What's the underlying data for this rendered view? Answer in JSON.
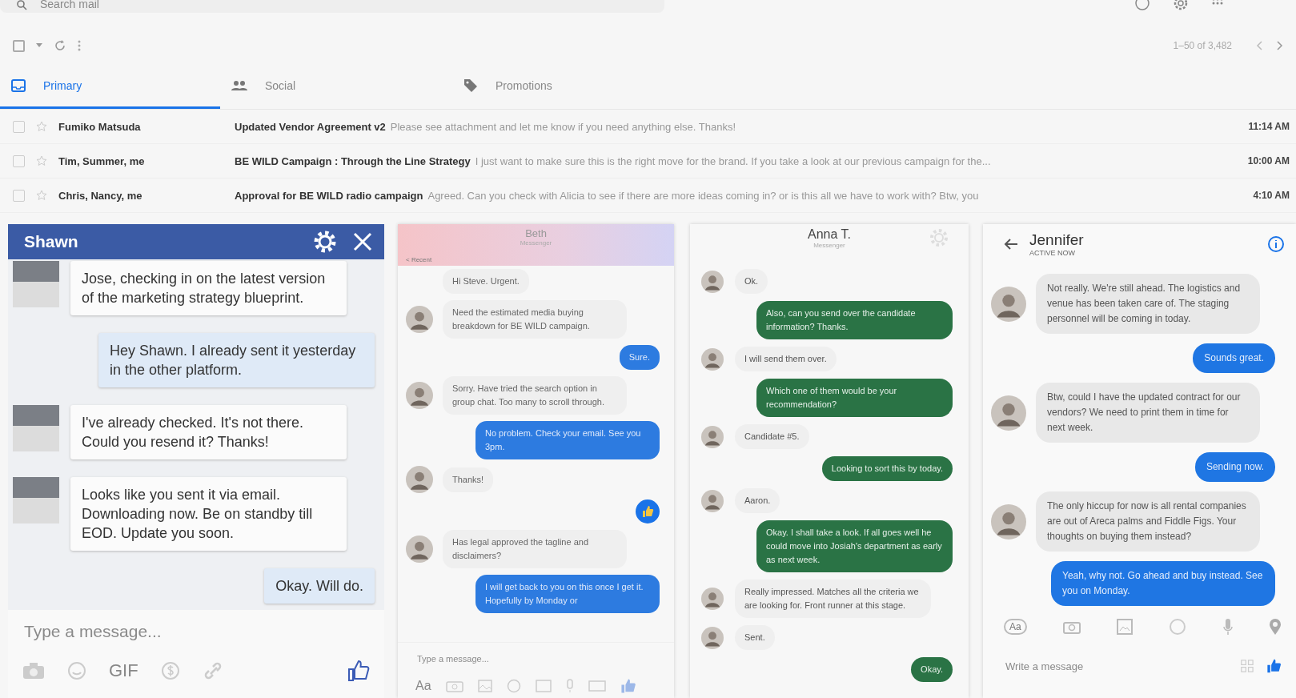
{
  "search": {
    "placeholder": "Search mail"
  },
  "toolbar": {
    "range": "1–50 of 3,482",
    "all_checked": false
  },
  "tabs": [
    {
      "label": "Primary",
      "selected": true,
      "kind": "inbox"
    },
    {
      "label": "Social",
      "selected": false,
      "kind": "people"
    },
    {
      "label": "Promotions",
      "selected": false,
      "kind": "tag"
    }
  ],
  "emails": [
    {
      "checked": false,
      "sender": "Fumiko Matsuda",
      "subject": "Updated Vendor Agreement v2",
      "snippet": "Please see attachment and let me know if you need anything else.  Thanks!",
      "time": "11:14 AM"
    },
    {
      "checked": false,
      "sender": "Tim, Summer, me",
      "subject": "BE WILD Campaign : Through the Line Strategy",
      "snippet": "I just want to make sure this is the right move for the brand. If you take a look at our previous campaign for the...",
      "time": "10:00 AM"
    },
    {
      "checked": false,
      "sender": "Chris, Nancy, me",
      "subject": "Approval for BE WILD radio campaign",
      "snippet": "Agreed. Can you check with Alicia to see if there are more ideas coming in? or is this all we have to work with? Btw, you",
      "time": "4:10 AM"
    }
  ],
  "chats": [
    {
      "kind": "classic",
      "title": "Shawn",
      "placeholder": "Type a message...",
      "footer_label": "GIF",
      "messages": [
        {
          "kind": "received",
          "text": "Jose, checking in on the latest version of the marketing strategy blueprint."
        },
        {
          "kind": "sent",
          "text": "Hey Shawn. I already sent it yesterday in the other platform."
        },
        {
          "kind": "received",
          "text": "I've already checked. It's not there. Could you resend it? Thanks!"
        },
        {
          "kind": "received",
          "text": "Looks like you sent it via email. Downloading now. Be on standby till EOD. Update you soon."
        },
        {
          "kind": "sent",
          "text": "Okay. Will do."
        }
      ]
    },
    {
      "kind": "gradient",
      "title": "Beth",
      "subtitle": "Messenger",
      "back": "< Recent",
      "placeholder": "Type a message...",
      "footer_label": "Aa",
      "messages": [
        {
          "kind": "received",
          "avatar": false,
          "text": "Hi Steve. Urgent."
        },
        {
          "kind": "received",
          "avatar": true,
          "text": "Need the estimated media buying breakdown for BE WILD campaign."
        },
        {
          "kind": "sent",
          "text": "Sure."
        },
        {
          "kind": "received",
          "avatar": true,
          "text": "Sorry. Have tried the search option in group chat. Too many to scroll through."
        },
        {
          "kind": "sent",
          "text": "No problem. Check your email. See you 3pm."
        },
        {
          "kind": "received",
          "avatar": true,
          "text": "Thanks!"
        },
        {
          "kind": "like"
        },
        {
          "kind": "received",
          "avatar": true,
          "text": "Has legal approved the tagline and disclaimers?"
        },
        {
          "kind": "sent",
          "text": "I will get back to you on this once I get it. Hopefully by Monday or"
        }
      ]
    },
    {
      "kind": "green",
      "title": "Anna T.",
      "subtitle": "Messenger",
      "messages": [
        {
          "kind": "received",
          "text": "Ok."
        },
        {
          "kind": "sent",
          "text": "Also, can you send over the candidate information? Thanks."
        },
        {
          "kind": "received",
          "text": "I will send them over."
        },
        {
          "kind": "sent",
          "text": "Which one of them would be your recommendation?"
        },
        {
          "kind": "received",
          "text": "Candidate #5."
        },
        {
          "kind": "sent",
          "text": "Looking to sort this by today."
        },
        {
          "kind": "received",
          "text": "Aaron."
        },
        {
          "kind": "sent",
          "text": "Okay. I shall take a look. If all goes well he could move into Josiah's department as early as next week."
        },
        {
          "kind": "received",
          "text": "Really impressed. Matches all the criteria we are looking for. Front runner at this stage."
        },
        {
          "kind": "received",
          "text": "Sent."
        },
        {
          "kind": "sent",
          "text": "Okay."
        }
      ]
    },
    {
      "kind": "material",
      "title": "Jennifer",
      "subtitle": "ACTIVE NOW",
      "placeholder": "Write a message",
      "footer_label": "Aa",
      "messages": [
        {
          "kind": "received",
          "text": "Not really. We're still ahead. The logistics and venue has been taken care of. The staging personnel will be coming in today."
        },
        {
          "kind": "sent",
          "text": "Sounds great."
        },
        {
          "kind": "received",
          "text": "Btw, could I have the updated contract for our vendors? We need to print them in time for next week."
        },
        {
          "kind": "sent",
          "text": "Sending now."
        },
        {
          "kind": "received",
          "text": "The only hiccup for now is all rental companies are out of Areca palms and Fiddle Figs. Your thoughts on buying them instead?"
        },
        {
          "kind": "sent",
          "text": "Yeah, why not. Go ahead and buy instead. See you on Monday."
        }
      ]
    }
  ]
}
